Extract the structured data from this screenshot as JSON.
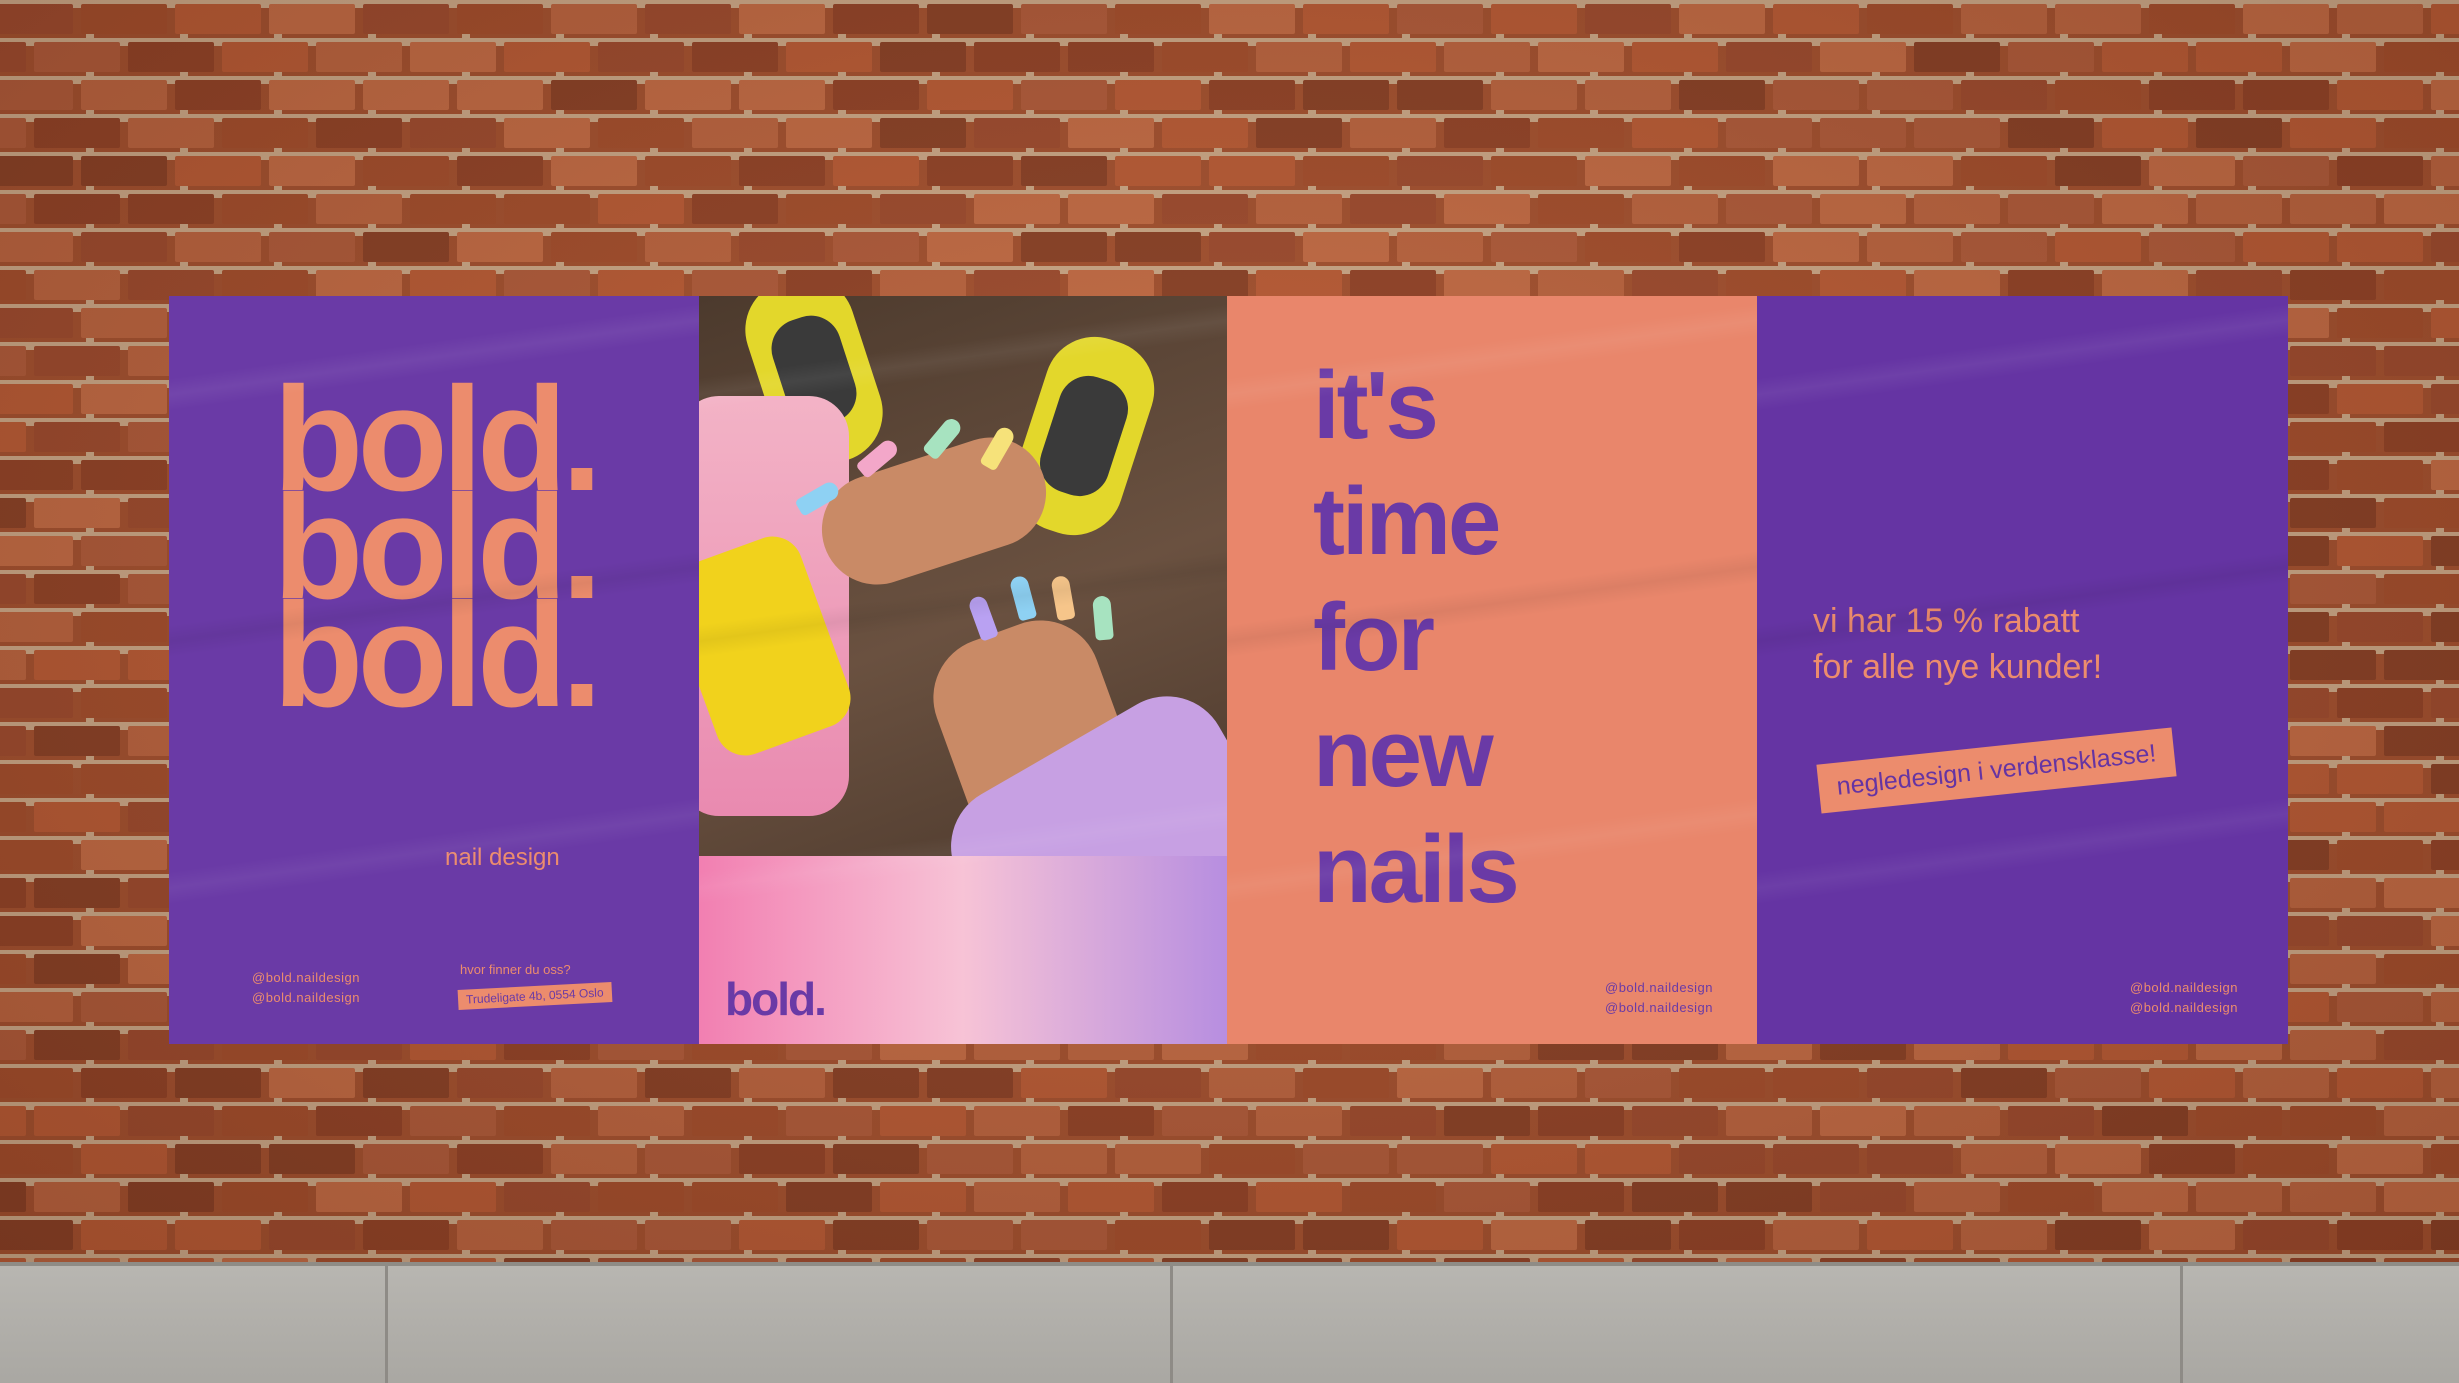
{
  "poster_left": {
    "words": [
      "bold.",
      "bold.",
      "bold."
    ],
    "tagline": "nail design",
    "handles": [
      "@bold.naildesign",
      "@bold.naildesign"
    ],
    "question": "hvor finner du oss?",
    "address": "Trudeligate 4b, 0554 Oslo"
  },
  "poster_photo": {
    "logo": "bold."
  },
  "poster_headline": {
    "lines": [
      "it's",
      "time",
      "for",
      "new",
      "nails"
    ],
    "handles": [
      "@bold.naildesign",
      "@bold.naildesign"
    ]
  },
  "poster_offer": {
    "offer_lines": [
      "vi har 15 % rabatt",
      "for alle nye kunder!"
    ],
    "stamp": "negledesign i verdensklasse!",
    "handles": [
      "@bold.naildesign",
      "@bold.naildesign"
    ]
  },
  "colors": {
    "purple": "#6a3aa6",
    "coral": "#ec8c6d",
    "brick": "#a1502f",
    "mortar": "#c9a888",
    "pavement": "#b0aea9"
  }
}
